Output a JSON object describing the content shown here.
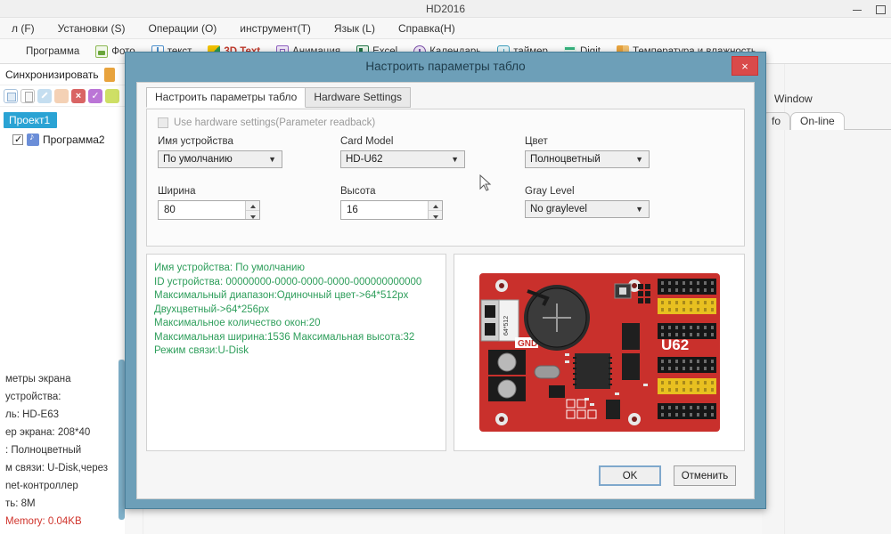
{
  "window": {
    "title": "HD2016",
    "minimize_label": "minimize",
    "maximize_label": "maximize"
  },
  "menubar": {
    "items": [
      {
        "label": "л (F)"
      },
      {
        "label": "Установки (S)"
      },
      {
        "label": "Операции (O)"
      },
      {
        "label": "инструмент(T)"
      },
      {
        "label": "Язык (L)"
      },
      {
        "label": "Справка(H)"
      }
    ]
  },
  "ribbon": {
    "items": [
      {
        "label": "Программа",
        "icon": "program-icon"
      },
      {
        "label": "Фото",
        "icon": "photo-icon"
      },
      {
        "label": "текст",
        "icon": "text-icon"
      },
      {
        "label": "3D Text",
        "icon": "3d-text-icon"
      },
      {
        "label": "Анимация",
        "icon": "animation-icon"
      },
      {
        "label": "Excel",
        "icon": "excel-icon"
      },
      {
        "label": "Календарь",
        "icon": "calendar-icon"
      },
      {
        "label": "таймер",
        "icon": "timer-icon"
      },
      {
        "label": "Digit",
        "icon": "digit-icon"
      },
      {
        "label": "Температура и влажность",
        "icon": "temperature-humidity-icon"
      }
    ]
  },
  "left_panel": {
    "sync_label": "Синхронизировать",
    "tree": {
      "project_label": "Проект1",
      "child_label": "Программа2"
    },
    "info_lines": [
      {
        "text": "метры экрана",
        "color": "#333333"
      },
      {
        "text": "устройства:",
        "color": "#333333"
      },
      {
        "text": "ль: HD-E63",
        "color": "#333333"
      },
      {
        "text": "ер экрана: 208*40",
        "color": "#333333"
      },
      {
        "text": ": Полноцветный",
        "color": "#333333"
      },
      {
        "text": "м связи: U-Disk,через",
        "color": "#333333"
      },
      {
        "text": "net-контроллер",
        "color": "#333333"
      },
      {
        "text": "ть: 8M",
        "color": "#333333"
      },
      {
        "text": "Memory: 0.04KB",
        "color": "#d0342c"
      }
    ]
  },
  "right_panel": {
    "title": "Window",
    "tabs": [
      {
        "label": "fo",
        "selected": false
      },
      {
        "label": "On-line",
        "selected": true
      }
    ]
  },
  "dialog": {
    "title": "Настроить параметры табло",
    "close_label": "×",
    "tabs": [
      {
        "label": "Настроить параметры табло",
        "selected": true
      },
      {
        "label": "Hardware Settings",
        "selected": false
      }
    ],
    "checkbox": {
      "label": "Use hardware settings(Parameter readback)",
      "checked": false
    },
    "fields": {
      "device_name": {
        "label": "Имя устройства",
        "value": "По умолчанию"
      },
      "card_model": {
        "label": "Card Model",
        "value": "HD-U62"
      },
      "color": {
        "label": "Цвет",
        "value": "Полноцветный"
      },
      "width": {
        "label": "Ширина",
        "value": "80"
      },
      "height": {
        "label": "Высота",
        "value": "16"
      },
      "gray_level": {
        "label": "Gray Level",
        "value": "No graylevel"
      }
    },
    "info_lines": [
      "Имя устройства: По умолчанию",
      "ID устройства:  00000000-0000-0000-0000-000000000000",
      "Максимальный диапазон:Одиночный цвет->64*512px",
      "Двухцветный->64*256px",
      "Максимальное количество окон:20",
      "Максимальная ширина:1536 Максимальная высота:32",
      "Режим связи:U-Disk"
    ],
    "board_label": "U62",
    "board_gnd_label": "GND",
    "buttons": {
      "ok": "OK",
      "cancel": "Отменить"
    }
  },
  "colors": {
    "dialog_frame": "#6d9fb8",
    "close_red": "#d94a4a",
    "info_green": "#2e9e5b",
    "memory_red": "#d0342c",
    "pcb_red": "#c9302c",
    "selection_blue": "#2aa3d4"
  }
}
